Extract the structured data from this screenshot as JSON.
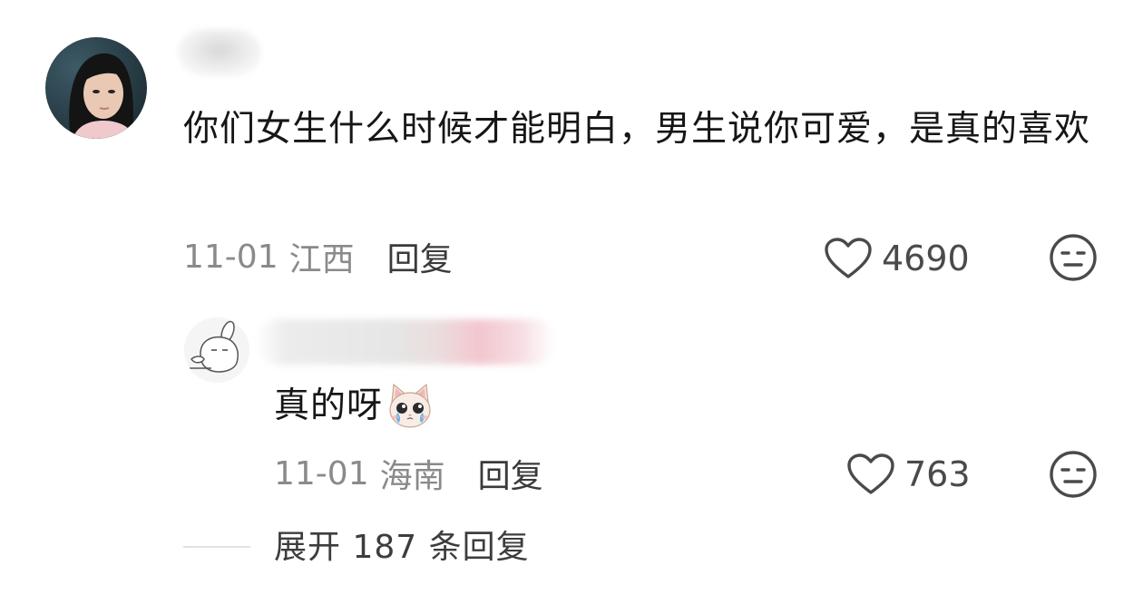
{
  "comment": {
    "text": "你们女生什么时候才能明白，男生说你可爱，是真的喜欢",
    "date": "11-01",
    "location": "江西",
    "reply_label": "回复",
    "likes": "4690"
  },
  "reply": {
    "text": "真的呀",
    "date": "11-01",
    "location": "海南",
    "reply_label": "回复",
    "likes": "763"
  },
  "expand": {
    "label": "展开 187 条回复"
  },
  "icons": {
    "like": "heart-outline-icon",
    "dislike": "neutral-face-icon",
    "emoji": "crying-cat-emoji"
  },
  "colors": {
    "text_primary": "#161616",
    "text_meta": "#8a8a8a",
    "icon_stroke": "#4a4a4a"
  }
}
